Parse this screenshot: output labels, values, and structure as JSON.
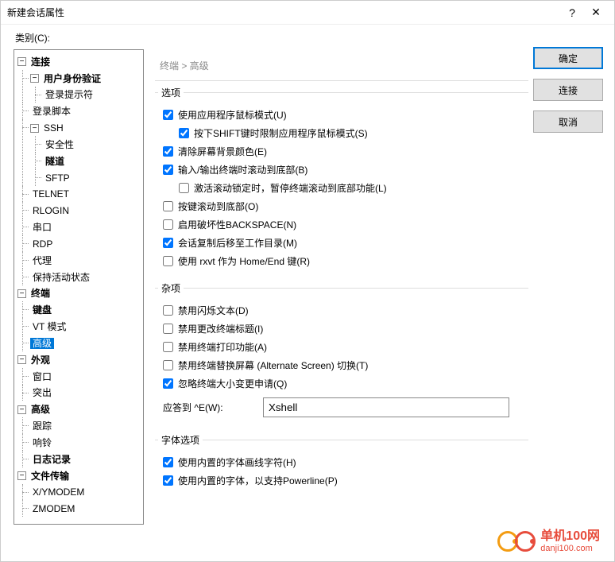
{
  "window": {
    "title": "新建会话属性",
    "help": "?",
    "close": "✕"
  },
  "category_label": "类别(C):",
  "breadcrumb": "终端 > 高级",
  "buttons": {
    "ok": "确定",
    "connect": "连接",
    "cancel": "取消"
  },
  "tree": {
    "connection": "连接",
    "auth": "用户身份验证",
    "login_prompt": "登录提示符",
    "login_script": "登录脚本",
    "ssh": "SSH",
    "security": "安全性",
    "tunnel": "隧道",
    "sftp": "SFTP",
    "telnet": "TELNET",
    "rlogin": "RLOGIN",
    "serial": "串口",
    "rdp": "RDP",
    "proxy": "代理",
    "keepalive": "保持活动状态",
    "terminal": "终端",
    "keyboard": "键盘",
    "vt": "VT 模式",
    "advanced_term": "高级",
    "appearance": "外观",
    "window": "窗口",
    "highlight": "突出",
    "advanced": "高级",
    "trace": "跟踪",
    "bell": "响铃",
    "logging": "日志记录",
    "filetransfer": "文件传输",
    "xymodem": "X/YMODEM",
    "zmodem": "ZMODEM"
  },
  "groups": {
    "options": {
      "legend": "选项",
      "use_app_mouse": "使用应用程序鼠标模式(U)",
      "shift_limit": "按下SHIFT键时限制应用程序鼠标模式(S)",
      "clear_bg": "清除屏幕背景颜色(E)",
      "scroll_bottom_io": "输入/输出终端时滚动到底部(B)",
      "scroll_lock": "激活滚动锁定时，暂停终端滚动到底部功能(L)",
      "scroll_bottom_key": "按键滚动到底部(O)",
      "destructive_bs": "启用破坏性BACKSPACE(N)",
      "restore_dir": "会话复制后移至工作目录(M)",
      "rxvt_home": "使用 rxvt 作为 Home/End 键(R)"
    },
    "misc": {
      "legend": "杂项",
      "disable_blink": "禁用闪烁文本(D)",
      "disable_title": "禁用更改终端标题(I)",
      "disable_print": "禁用终端打印功能(A)",
      "disable_altscreen": "禁用终端替换屏幕 (Alternate Screen) 切换(T)",
      "ignore_resize": "忽略终端大小变更申请(Q)",
      "answerback_label": "应答到 ^E(W):",
      "answerback_value": "Xshell"
    },
    "font": {
      "legend": "字体选项",
      "builtin_linedraw": "使用内置的字体画线字符(H)",
      "builtin_powerline": "使用内置的字体，以支持Powerline(P)"
    }
  },
  "checked": {
    "use_app_mouse": true,
    "shift_limit": true,
    "clear_bg": true,
    "scroll_bottom_io": true,
    "scroll_lock": false,
    "scroll_bottom_key": false,
    "destructive_bs": false,
    "restore_dir": true,
    "rxvt_home": false,
    "disable_blink": false,
    "disable_title": false,
    "disable_print": false,
    "disable_altscreen": false,
    "ignore_resize": true,
    "builtin_linedraw": true,
    "builtin_powerline": true
  },
  "watermark": {
    "cn": "单机100网",
    "url": "danji100.com"
  }
}
